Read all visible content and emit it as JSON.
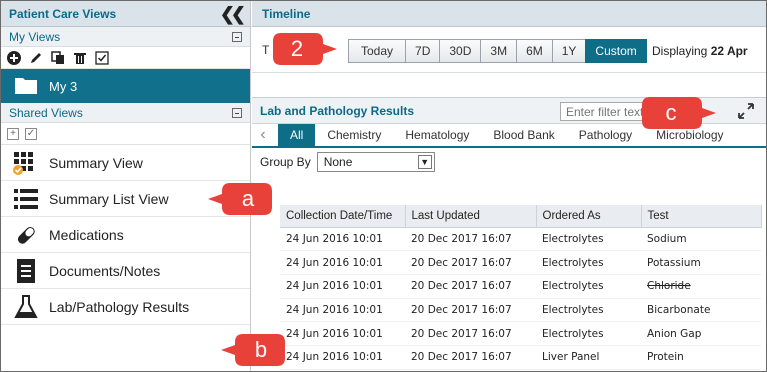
{
  "left_panel": {
    "title": "Patient Care Views",
    "my_views_label": "My Views",
    "my_view_item": "My 3",
    "shared_views_label": "Shared Views",
    "views": [
      {
        "label": "Summary View",
        "icon": "summary-grid-icon"
      },
      {
        "label": "Summary List View",
        "icon": "list-icon"
      },
      {
        "label": "Medications",
        "icon": "pill-icon"
      },
      {
        "label": "Documents/Notes",
        "icon": "document-icon"
      },
      {
        "label": "Lab/Pathology Results",
        "icon": "flask-icon"
      }
    ]
  },
  "timeline": {
    "title": "Timeline",
    "label": "T",
    "ranges": [
      "Today",
      "7D",
      "30D",
      "3M",
      "6M",
      "1Y",
      "Custom"
    ],
    "active_range": "Custom",
    "displaying_prefix": "Displaying",
    "displaying_value": "22 Apr"
  },
  "lab": {
    "title": "Lab and Pathology Results",
    "filter_placeholder": "Enter filter text...",
    "tabs": [
      "All",
      "Chemistry",
      "Hematology",
      "Blood Bank",
      "Pathology",
      "Microbiology"
    ],
    "active_tab": "All",
    "group_by_label": "Group By",
    "group_by_value": "None",
    "columns": [
      "Collection Date/Time",
      "Last Updated",
      "Ordered As",
      "Test"
    ],
    "rows": [
      [
        "24 Jun 2016 10:01",
        "20 Dec 2017 16:07",
        "Electrolytes",
        "Sodium"
      ],
      [
        "24 Jun 2016 10:01",
        "20 Dec 2017 16:07",
        "Electrolytes",
        "Potassium"
      ],
      [
        "24 Jun 2016 10:01",
        "20 Dec 2017 16:07",
        "Electrolytes",
        "Chloride"
      ],
      [
        "24 Jun 2016 10:01",
        "20 Dec 2017 16:07",
        "Electrolytes",
        "Bicarbonate"
      ],
      [
        "24 Jun 2016 10:01",
        "20 Dec 2017 16:07",
        "Electrolytes",
        "Anion Gap"
      ],
      [
        "24 Jun 2016 10:01",
        "20 Dec 2017 16:07",
        "Liver Panel",
        "Protein"
      ]
    ]
  },
  "callouts": {
    "two": "2",
    "a": "a",
    "b": "b",
    "c": "c"
  },
  "colors": {
    "accent": "#0e6d87",
    "callout": "#e8413a"
  }
}
